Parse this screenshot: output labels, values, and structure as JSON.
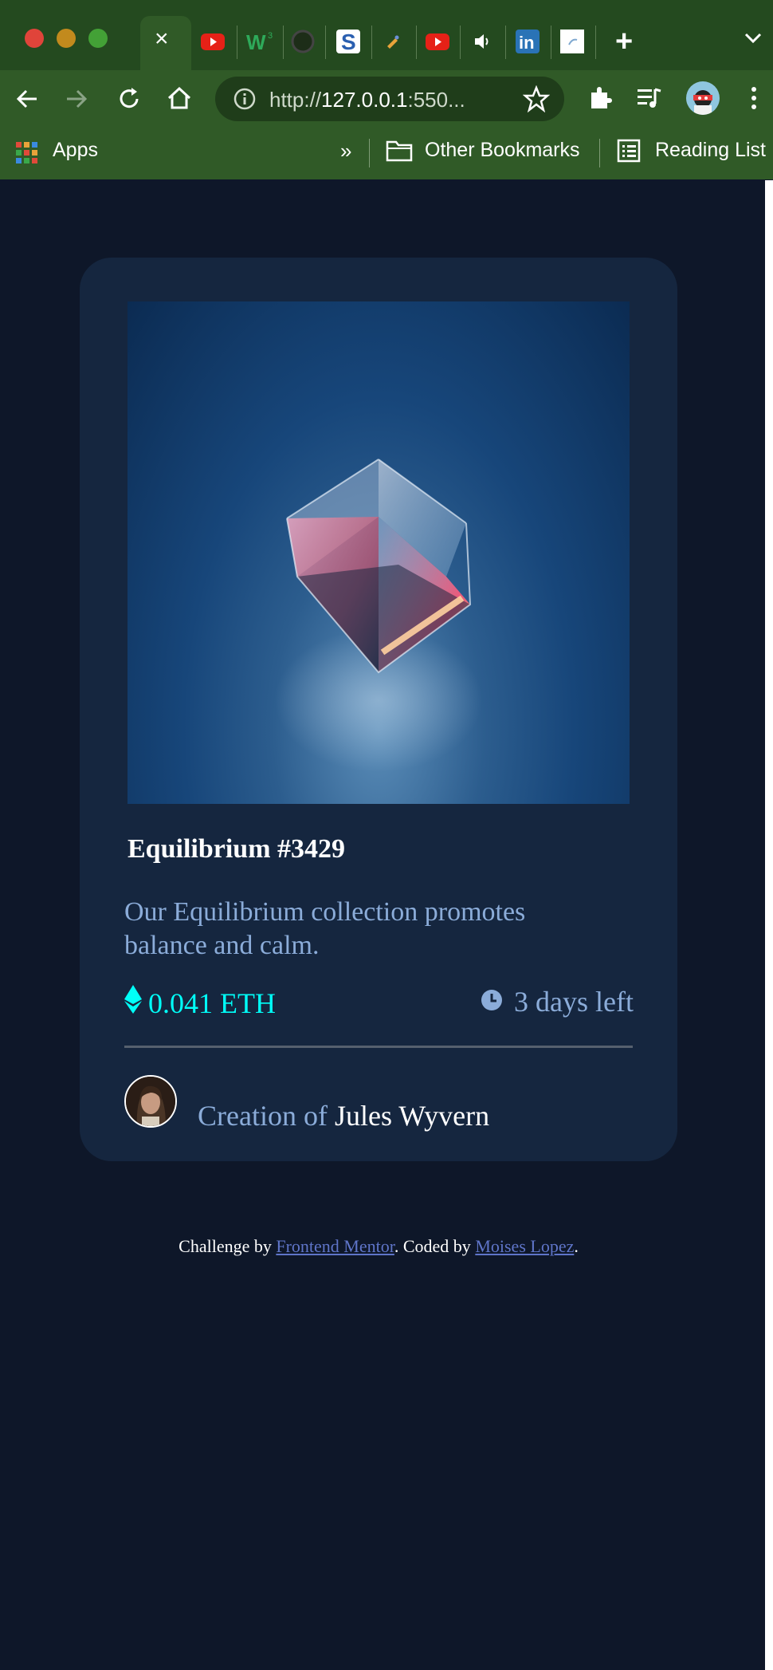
{
  "browser": {
    "url_prefix": "http://",
    "url_host": "127.0.0.1",
    "url_rest": ":550...",
    "bookmarks": {
      "apps_label": "Apps",
      "overflow": "»",
      "other_label": "Other Bookmarks",
      "reading_label": "Reading List"
    },
    "new_tab": "+",
    "close_tab": "×",
    "colors": {
      "chrome": "#305a27",
      "tabstrip": "#244a1f"
    }
  },
  "card": {
    "title": "Equilibrium #3429",
    "description": "Our Equilibrium collection promotes balance and calm.",
    "price": "0.041 ETH",
    "time_left": "3 days left",
    "creator_prefix": "Creation of ",
    "creator_name": "Jules Wyvern",
    "colors": {
      "accent": "#00fff8",
      "soft_blue": "#8bacd9",
      "card_bg": "#15263f",
      "page_bg": "#0e1729"
    }
  },
  "attribution": {
    "prefix": "Challenge by ",
    "link1": "Frontend Mentor",
    "middle": ". Coded by ",
    "link2": "Moises Lopez",
    "suffix": "."
  }
}
